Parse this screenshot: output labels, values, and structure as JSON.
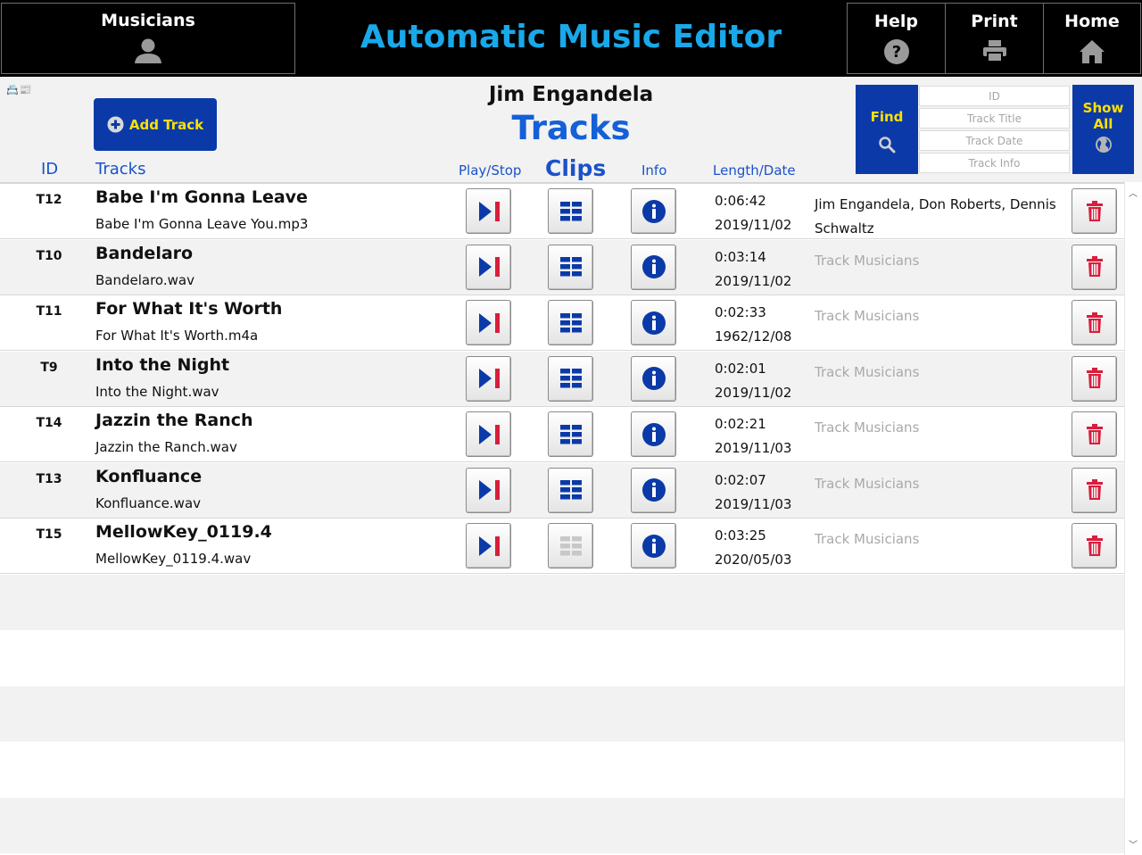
{
  "topbar": {
    "musicians_label": "Musicians",
    "app_title": "Automatic Music Editor",
    "help_label": "Help",
    "print_label": "Print",
    "home_label": "Home"
  },
  "header": {
    "add_track_label": "Add Track",
    "person_name": "Jim Engandela",
    "page_title": "Tracks",
    "mini_icons": "📇📰"
  },
  "columns": {
    "id": "ID",
    "tracks": "Tracks",
    "play_stop": "Play/Stop",
    "clips": "Clips",
    "info": "Info",
    "length_date": "Length/Date"
  },
  "find": {
    "find_label": "Find",
    "show_all_line1": "Show",
    "show_all_line2": "All",
    "id_placeholder": "ID",
    "title_placeholder": "Track Title",
    "date_placeholder": "Track Date",
    "info_placeholder": "Track Info"
  },
  "tracks": [
    {
      "id": "T12",
      "title": "Babe I'm Gonna Leave",
      "file": "Babe I'm Gonna Leave You.mp3",
      "length": "0:06:42",
      "date": "2019/11/02",
      "musicians": "Jim Engandela, Don Roberts, Dennis Schwaltz",
      "has_musicians": true,
      "clips_enabled": true
    },
    {
      "id": "T10",
      "title": "Bandelaro",
      "file": "Bandelaro.wav",
      "length": "0:03:14",
      "date": "2019/11/02",
      "musicians": "Track Musicians",
      "has_musicians": false,
      "clips_enabled": true
    },
    {
      "id": "T11",
      "title": "For What It's Worth",
      "file": "For What It's Worth.m4a",
      "length": "0:02:33",
      "date": "1962/12/08",
      "musicians": "Track Musicians",
      "has_musicians": false,
      "clips_enabled": true
    },
    {
      "id": "T9",
      "title": "Into the Night",
      "file": "Into the Night.wav",
      "length": "0:02:01",
      "date": "2019/11/02",
      "musicians": "Track Musicians",
      "has_musicians": false,
      "clips_enabled": true
    },
    {
      "id": "T14",
      "title": "Jazzin the Ranch",
      "file": "Jazzin the Ranch.wav",
      "length": "0:02:21",
      "date": "2019/11/03",
      "musicians": "Track Musicians",
      "has_musicians": false,
      "clips_enabled": true
    },
    {
      "id": "T13",
      "title": "Konfluance",
      "file": "Konfluance.wav",
      "length": "0:02:07",
      "date": "2019/11/03",
      "musicians": "Track Musicians",
      "has_musicians": false,
      "clips_enabled": true
    },
    {
      "id": "T15",
      "title": "MellowKey_0119.4",
      "file": "MellowKey_0119.4.wav",
      "length": "0:03:25",
      "date": "2020/05/03",
      "musicians": "Track Musicians",
      "has_musicians": false,
      "clips_enabled": false
    }
  ],
  "colors": {
    "accent_blue": "#0b3aa8",
    "title_cyan": "#19a8e9",
    "header_blue": "#1a52c9",
    "yellow": "#ffe000",
    "delete_red": "#d81e3c"
  },
  "icons": {
    "musicians": "person-icon",
    "help": "question-circle-icon",
    "print": "printer-icon",
    "home": "home-icon",
    "add": "plus-circle-icon",
    "find": "magnifier-icon",
    "show_all": "globe-icon",
    "play": "play-stop-icon",
    "clips": "grid-icon",
    "info": "info-circle-icon",
    "delete": "trash-icon"
  }
}
